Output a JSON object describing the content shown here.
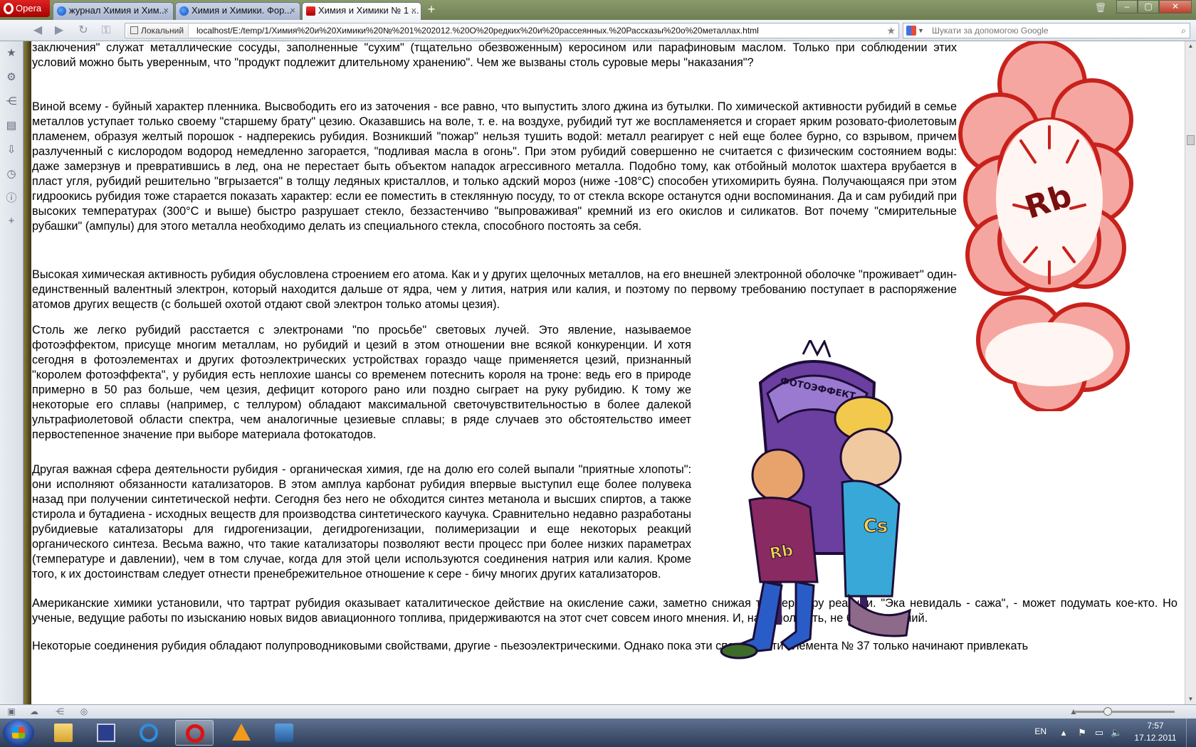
{
  "browser": {
    "menu_label": "Opera",
    "tabs": [
      {
        "title": "журнал Химия и Хим..."
      },
      {
        "title": "Химия и Химики. Фор..."
      },
      {
        "title": "Химия и Химики № 1 ..."
      }
    ],
    "address": {
      "badge": "Локальний",
      "url": "localhost/E:/temp/1/Химия%20и%20Химики%20№%201%202012.%20О%20редких%20и%20рассеянных.%20Рассказы%20о%20металлах.html"
    },
    "search": {
      "placeholder": "Шукати за допомогою Google"
    }
  },
  "article": {
    "p1": "заключения\" служат металлические сосуды, заполненные \"сухим\" (тщательно обезвоженным) керосином или парафиновым маслом. Только при соблюдении этих условий можно быть уверенным, что \"продукт подлежит длительному хранению\". Чем же вызваны столь суровые меры \"наказания\"?",
    "p2": "Виной всему - буйный характер пленника. Высвободить его из заточения - все равно, что выпустить злого джина из бутылки. По химической активности рубидий в семье металлов уступает только своему \"старшему брату\" цезию. Оказавшись на воле, т. е. на воздухе, рубидий тут же воспламеняется и сгорает ярким розовато-фиолетовым пламенем, образуя желтый порошок - надперекись рубидия. Возникший \"пожар\" нельзя тушить водой: металл реагирует с ней еще более бурно, со взрывом, причем разлученный с кислородом водород немедленно загорается, \"подливая масла в огонь\". При этом рубидий совершенно не считается с физическим состоянием воды: даже замерзнув и превратившись в лед, она не перестает быть объектом нападок агрессивного металла. Подобно тому, как отбойный молоток шахтера врубается в пласт угля, рубидий решительно \"вгрызается\" в толщу ледяных кристаллов, и только адский мороз (ниже -108°С) способен утихомирить буяна. Получающаяся при этом гидроокись рубидия тоже старается показать характер: если ее поместить в стеклянную посуду, то от стекла вскоре останутся одни воспоминания. Да и сам рубидий при высоких температурах (300°С и выше) быстро разрушает стекло, беззастенчиво \"выпроваживая\" кремний из его окислов и силикатов. Вот почему \"смирительные рубашки\" (ампулы) для этого металла необходимо делать из специального стекла, способного постоять за себя.",
    "p3": "Высокая химическая активность рубидия обусловлена строением его атома. Как и у других щелочных металлов, на его внешней электронной оболочке \"проживает\" один-единственный валентный электрон, который находится дальше от ядра, чем у лития, натрия или калия, и поэтому по первому требованию поступает в распоряжение атомов других веществ (с большей охотой отдают свой электрон только атомы цезия).",
    "p4": "Столь же легко рубидий расстается с электронами \"по просьбе\" световых лучей. Это явление, называемое фотоэффектом, присуще многим металлам, но рубидий и цезий в этом отношении вне всякой конкуренции. И хотя сегодня в фотоэлементах и других фотоэлектрических устройствах гораздо чаще применяется цезий, признанный \"королем фотоэффекта\", у рубидия есть неплохие шансы со временем потеснить короля на троне: ведь его в природе примерно в 50 раз больше, чем цезия, дефицит которого рано или поздно сыграет на руку рубидию. К тому же некоторые его сплавы (например, с теллуром) обладают максимальной светочувствительностью в более далекой ультрафиолетовой области спектра, чем аналогичные цезиевые сплавы; в ряде случаев это обстоятельство имеет первостепенное значение при выборе материала фотокатодов.",
    "p5": "Другая важная сфера деятельности рубидия - органическая химия, где на долю его солей выпали \"приятные хлопоты\": они исполняют обязанности катализаторов. В этом амплуа карбонат рубидия впервые выступил еще более полувека назад при получении синтетической нефти. Сегодня без него не обходится синтез метанола и высших спиртов, а также стирола и бутадиена - исходных веществ для производства синтетического каучука. Сравнительно недавно разработаны рубидиевые катализаторы для гидрогенизации, дегидрогенизации, полимеризации и еще некоторых реакций органического синтеза. Весьма важно, что такие катализаторы позволяют вести процесс при более низких параметрах (температуре и давлении), чем в том случае, когда для этой цели используются соединения натрия или калия. Кроме того, к их достоинствам следует отнести пренебрежительное отношение к сере - бичу многих других катализаторов.",
    "p6": "Американские химики установили, что тартрат рубидия оказывает каталитическое действие на окисление сажи, заметно снижая температуру реакции. \"Эка невидаль - сажа\", - может подумать кое-кто. Но ученые, ведущие работы по изысканию новых видов авиационного топлива, придерживаются на этот счет совсем иного мнения. И, надо полагать, не без оснований.",
    "p7": "Некоторые соединения рубидия обладают полупроводниковыми свойствами, другие - пьезоэлектрическими. Однако пока эти способности элемента № 37 только начинают привлекать"
  },
  "illustrations": {
    "explosion_label": "Rb",
    "throne_label": "ФОТОЭФФЕКТ",
    "king_badge": "Cs",
    "rival_badge": "Rb"
  },
  "taskbar": {
    "lang": "EN",
    "time": "7:57",
    "date": "17.12.2011"
  },
  "colors": {
    "opera_red": "#cc1111",
    "explosion_red": "#d8231f",
    "throne_purple": "#6a3fa0"
  }
}
